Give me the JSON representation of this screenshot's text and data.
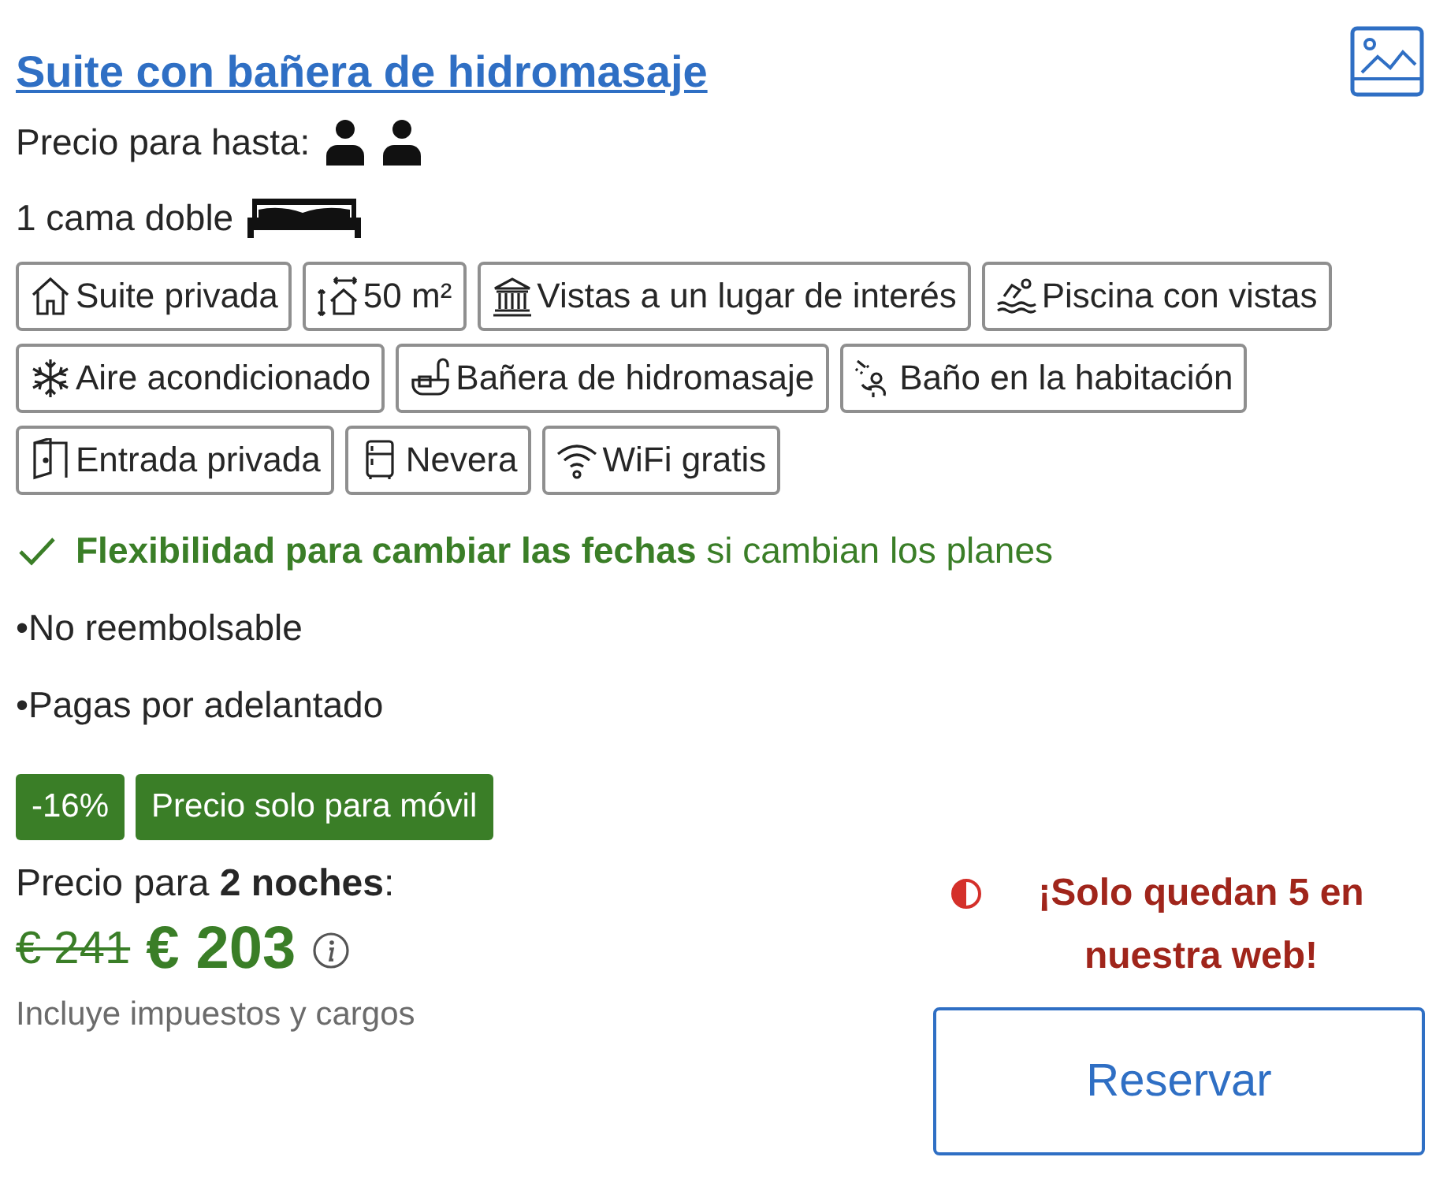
{
  "room": {
    "title": "Suite con bañera de hidromasaje",
    "guests_label": "Precio para hasta:",
    "bed": "1 cama doble"
  },
  "facilities": [
    {
      "kind": "house",
      "label": "Suite privada"
    },
    {
      "kind": "area",
      "label": "50 m²"
    },
    {
      "kind": "landmark",
      "label": "Vistas a un lugar de interés"
    },
    {
      "kind": "pool",
      "label": "Piscina con vistas"
    },
    {
      "kind": "snowflake",
      "label": "Aire acondicionado"
    },
    {
      "kind": "bathtub",
      "label": "Bañera de hidromasaje"
    },
    {
      "kind": "shower",
      "label": "Baño en la habitación"
    },
    {
      "kind": "door",
      "label": "Entrada privada"
    },
    {
      "kind": "fridge",
      "label": "Nevera"
    },
    {
      "kind": "wifi",
      "label": "WiFi gratis"
    }
  ],
  "flexibility": "**Flexibilidad para cambiar las fechas** si cambian los planes",
  "conditions": [
    "•No reembolsable",
    "•Pagas por adelantado"
  ],
  "badges": [
    "-16%",
    "Precio solo para móvil"
  ],
  "price": {
    "label": "Precio para **2 noches**:",
    "old": "€ 241",
    "current": "€ 203",
    "taxes": "Incluye impuestos y cargos"
  },
  "availability": "¡Solo quedan 5 en nuestra web!",
  "button": "Reservar"
}
